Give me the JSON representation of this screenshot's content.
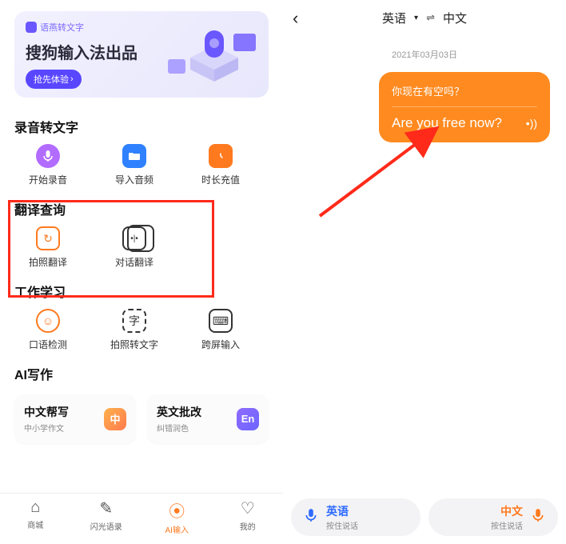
{
  "banner": {
    "tag": "语燕转文字",
    "title": "搜狗输入法出品",
    "button": "抢先体验"
  },
  "sections": {
    "recording": {
      "title": "录音转文字",
      "items": [
        {
          "label": "开始录音"
        },
        {
          "label": "导入音频"
        },
        {
          "label": "时长充值"
        }
      ]
    },
    "translate": {
      "title": "翻译查询",
      "items": [
        {
          "label": "拍照翻译"
        },
        {
          "label": "对话翻译"
        }
      ]
    },
    "study": {
      "title": "工作学习",
      "items": [
        {
          "label": "口语检测"
        },
        {
          "label": "拍照转文字"
        },
        {
          "label": "跨屏输入"
        }
      ]
    },
    "ai": {
      "title": "AI写作",
      "cards": [
        {
          "title": "中文帮写",
          "subtitle": "中小学作文",
          "badge": "中"
        },
        {
          "title": "英文批改",
          "subtitle": "纠错润色",
          "badge": "En"
        }
      ]
    }
  },
  "nav": {
    "items": [
      {
        "label": "商城"
      },
      {
        "label": "闪光语录"
      },
      {
        "label": "AI输入"
      },
      {
        "label": "我的"
      }
    ]
  },
  "right": {
    "header": {
      "src": "英语",
      "swap": "⇌",
      "tgt": "中文"
    },
    "date": "2021年03月03日",
    "message": {
      "source": "你现在有空吗？",
      "target": "Are you free now?"
    },
    "buttons": {
      "left": {
        "lang": "英语",
        "hint": "按住说话"
      },
      "right": {
        "lang": "中文",
        "hint": "按住说话"
      }
    }
  },
  "colors": {
    "accent_orange": "#ff7a1f",
    "accent_blue": "#2f6bff"
  }
}
